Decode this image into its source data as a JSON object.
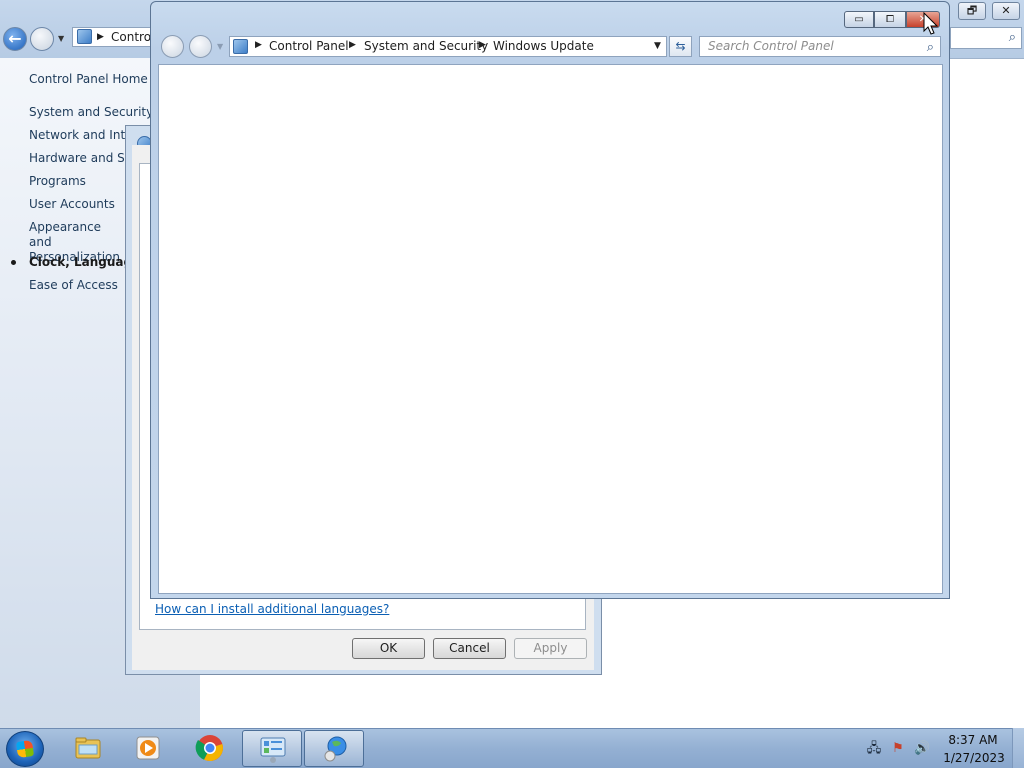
{
  "background_window": {
    "address_text": "Control",
    "caption_buttons": [
      "🗗",
      "✕"
    ],
    "sidebar": {
      "items": [
        {
          "label": "Control Panel Home"
        },
        {
          "label": "System and Security"
        },
        {
          "label": "Network and Inter"
        },
        {
          "label": "Hardware and Sou"
        },
        {
          "label": "Programs"
        },
        {
          "label": "User Accounts"
        },
        {
          "label": "Appearance and Personalization"
        },
        {
          "label": "Clock, Language, a",
          "current": true
        },
        {
          "label": "Ease of Access"
        }
      ]
    }
  },
  "region_dialog": {
    "help_link": "How can I install additional languages?",
    "buttons": {
      "ok": "OK",
      "cancel": "Cancel",
      "apply": "Apply"
    }
  },
  "windows_update_window": {
    "breadcrumb": [
      "Control Panel",
      "System and Security",
      "Windows Update"
    ],
    "search_placeholder": "Search Control Panel",
    "caption": {
      "minimize": "▭",
      "maximize": "⧠",
      "close": "✕"
    }
  },
  "taskbar": {
    "items": [
      {
        "icon": "file-explorer-icon"
      },
      {
        "icon": "media-player-icon"
      },
      {
        "icon": "chrome-icon"
      },
      {
        "icon": "control-panel-icon",
        "active": true
      },
      {
        "icon": "windows-update-globe-icon",
        "active": true
      }
    ],
    "clock": {
      "time": "8:37 AM",
      "date": "1/27/2023"
    }
  },
  "colors": {
    "link": "#0b5fb4",
    "titlebar": "#c5d7ec",
    "close_button": "#c7412b",
    "taskbar": "#94b0d3"
  }
}
